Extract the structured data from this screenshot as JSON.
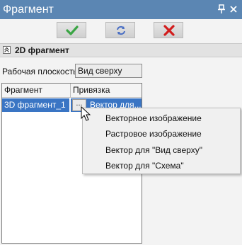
{
  "window": {
    "title": "Фрагмент",
    "pin_icon": "pin-icon",
    "close_icon": "close-icon"
  },
  "toolbar": {
    "ok": {
      "icon": "checkmark-icon",
      "color": "#3aa544"
    },
    "refresh": {
      "icon": "refresh-icon",
      "color": "#4a6fc4"
    },
    "cancel": {
      "icon": "cross-icon",
      "color": "#d21c1c"
    }
  },
  "section": {
    "title": "2D фрагмент",
    "collapse_icon": "collapse-icon"
  },
  "work_plane": {
    "label": "Рабочая плоскость:",
    "value": "Вид сверху"
  },
  "table": {
    "columns": [
      "Фрагмент",
      "Привязка"
    ],
    "rows": [
      {
        "fragment": "3D фрагмент_1",
        "button": "...",
        "binding": "Вектор для..."
      }
    ]
  },
  "context_menu": {
    "items": [
      "Векторное изображение",
      "Растровое изображение",
      "Вектор для \"Вид сверху\"",
      "Вектор для \"Схема\""
    ]
  },
  "colors": {
    "titlebar": "#5b86b3",
    "selection": "#3a75c4"
  }
}
